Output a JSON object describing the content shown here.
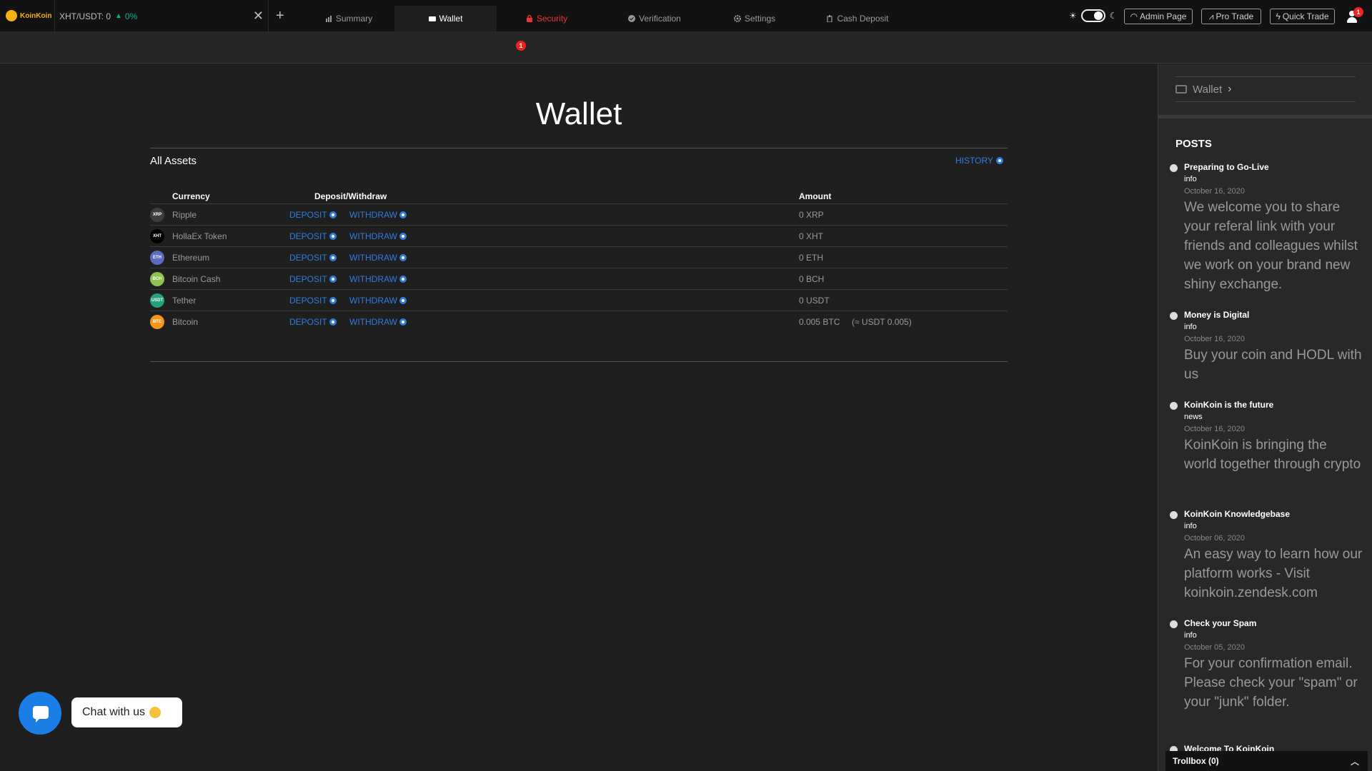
{
  "topbar": {
    "brand": "KoinKoin",
    "pair_tab": {
      "pair": "XHT/USDT: 0",
      "change": "0%"
    },
    "buttons": {
      "admin": "Admin Page",
      "pro_trade": "Pro Trade",
      "quick_trade": "Quick Trade"
    },
    "notification_count": "1",
    "theme_sun": "☀",
    "theme_moon": "☾"
  },
  "nav": {
    "tabs": [
      {
        "label": "Summary"
      },
      {
        "label": "Wallet"
      },
      {
        "label": "Security",
        "badge": "1"
      },
      {
        "label": "Verification"
      },
      {
        "label": "Settings"
      },
      {
        "label": "Cash Deposit"
      }
    ]
  },
  "main": {
    "title": "Wallet",
    "assets_title": "All Assets",
    "history_label": "HISTORY",
    "columns": {
      "currency": "Currency",
      "deposit_withdraw": "Deposit/Withdraw",
      "amount": "Amount"
    },
    "deposit_label": "DEPOSIT",
    "withdraw_label": "WITHDRAW",
    "assets": [
      {
        "code": "XRP",
        "name": "Ripple",
        "amount": "0 XRP",
        "approx": "",
        "color": "#3d3d3d"
      },
      {
        "code": "XHT",
        "name": "HollaEx Token",
        "amount": "0 XHT",
        "approx": "",
        "color": "#000000"
      },
      {
        "code": "ETH",
        "name": "Ethereum",
        "amount": "0 ETH",
        "approx": "",
        "color": "#5b6bbf"
      },
      {
        "code": "BCH",
        "name": "Bitcoin Cash",
        "amount": "0 BCH",
        "approx": "",
        "color": "#8dc351"
      },
      {
        "code": "USDT",
        "name": "Tether",
        "amount": "0 USDT",
        "approx": "",
        "color": "#26a17b"
      },
      {
        "code": "BTC",
        "name": "Bitcoin",
        "amount": "0.005 BTC",
        "approx": "(≈ USDT 0.005)",
        "color": "#f7931a"
      }
    ]
  },
  "chat": {
    "label": "Chat with us"
  },
  "sidebar": {
    "crumb": "Wallet",
    "posts_title": "POSTS",
    "posts": [
      {
        "title": "Preparing to Go-Live",
        "category": "info",
        "date": "October 16, 2020",
        "body": "We welcome you to share your referal link with your friends and colleagues whilst we work on your brand new shiny exchange."
      },
      {
        "title": "Money is Digital",
        "category": "info",
        "date": "October 16, 2020",
        "body": "Buy your coin and HODL with us"
      },
      {
        "title": "KoinKoin is the future",
        "category": "news",
        "date": "October 16, 2020",
        "body": "KoinKoin is bringing the world together through crypto"
      },
      {
        "title": "KoinKoin Knowledgebase",
        "category": "info",
        "date": "October 06, 2020",
        "body": "An easy way to learn how our platform works - Visit koinkoin.zendesk.com"
      },
      {
        "title": "Check your Spam",
        "category": "info",
        "date": "October 05, 2020",
        "body": "For your confirmation email. Please check your \"spam\" or your \"junk\" folder."
      },
      {
        "title": "Welcome To KoinKoin",
        "category": "",
        "date": "",
        "body": ""
      }
    ],
    "trollbox": "Trollbox (0)"
  }
}
